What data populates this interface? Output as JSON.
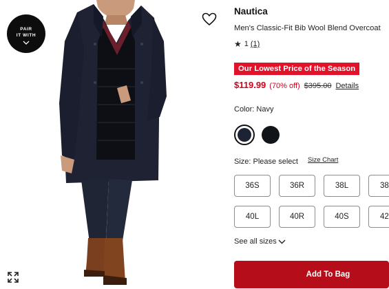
{
  "image_panel": {
    "pair_badge_text": "PAIR\nIT WITH",
    "pair_badge_icon": "chevron-down-icon",
    "favorite_icon": "heart-icon",
    "expand_icon": "expand-icon"
  },
  "product": {
    "brand": "Nautica",
    "name": "Men's Classic-Fit Bib Wool Blend Overcoat",
    "rating_star": "★",
    "rating_value": "1",
    "review_count": "(1)"
  },
  "promo": {
    "banner": "Our Lowest Price of the Season",
    "color": "#e0132b"
  },
  "price": {
    "sale": "$119.99",
    "percent_off": "(70% off)",
    "original": "$395.00",
    "details_link": "Details",
    "color": "#d0021b"
  },
  "color_selector": {
    "label": "Color: Navy",
    "swatches": [
      {
        "name": "Navy",
        "hex": "#1c2333",
        "selected": true
      },
      {
        "name": "Black",
        "hex": "#111418",
        "selected": false
      }
    ]
  },
  "size_selector": {
    "label": "Size: Please select",
    "size_chart_link": "Size Chart",
    "rows": [
      [
        "36S",
        "36R",
        "38L",
        "38"
      ],
      [
        "40L",
        "40R",
        "40S",
        "42"
      ]
    ],
    "see_all": "See all sizes"
  },
  "cta": {
    "add_to_bag": "Add To Bag",
    "color": "#b50d1a"
  }
}
